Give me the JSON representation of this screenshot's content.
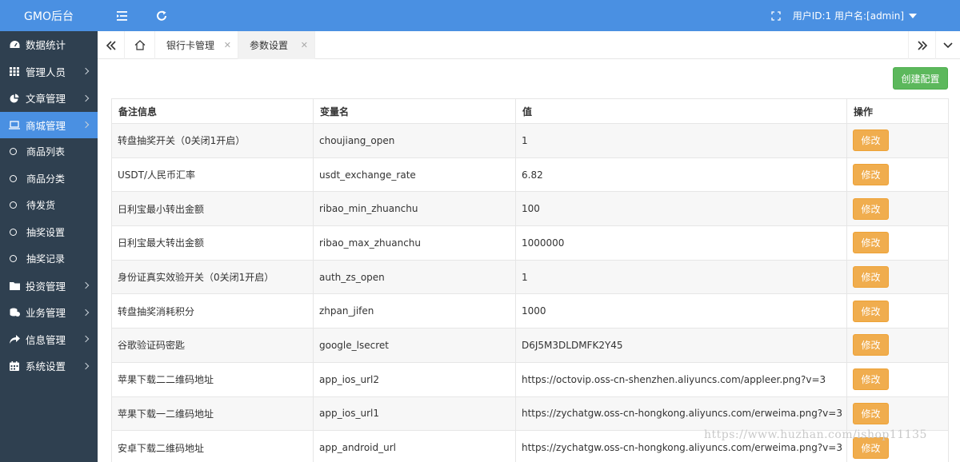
{
  "app": {
    "title": "GMO后台"
  },
  "sidebar": {
    "items": [
      {
        "label": "数据统计",
        "icon": "dashboard-icon",
        "has_arrow": false,
        "active": false
      },
      {
        "label": "管理人员",
        "icon": "grid-icon",
        "has_arrow": true,
        "active": false
      },
      {
        "label": "文章管理",
        "icon": "pie-chart-icon",
        "has_arrow": true,
        "active": false
      },
      {
        "label": "商城管理",
        "icon": "laptop-icon",
        "has_arrow": true,
        "active": true
      },
      {
        "label": "商品列表",
        "sub": true
      },
      {
        "label": "商品分类",
        "sub": true
      },
      {
        "label": "待发货",
        "sub": true
      },
      {
        "label": "抽奖设置",
        "sub": true
      },
      {
        "label": "抽奖记录",
        "sub": true
      },
      {
        "label": "投资管理",
        "icon": "folder-icon",
        "has_arrow": true,
        "active": false
      },
      {
        "label": "业务管理",
        "icon": "coins-icon",
        "has_arrow": true,
        "active": false
      },
      {
        "label": "信息管理",
        "icon": "share-icon",
        "has_arrow": true,
        "active": false
      },
      {
        "label": "系统设置",
        "icon": "calendar-icon",
        "has_arrow": true,
        "active": false
      }
    ]
  },
  "header": {
    "user_label": "用户ID:1 用户名:[admin]"
  },
  "tabs": [
    {
      "label": "银行卡管理",
      "active": false
    },
    {
      "label": "参数设置",
      "active": true
    }
  ],
  "toolbar": {
    "create_label": "创建配置"
  },
  "table": {
    "columns": [
      "备注信息",
      "变量名",
      "值",
      "操作"
    ],
    "edit_label": "修改",
    "rows": [
      {
        "note": "转盘抽奖开关（0关闭1开启）",
        "name": "choujiang_open",
        "value": "1"
      },
      {
        "note": "USDT/人民币汇率",
        "name": "usdt_exchange_rate",
        "value": "6.82"
      },
      {
        "note": "日利宝最小转出金额",
        "name": "ribao_min_zhuanchu",
        "value": "100"
      },
      {
        "note": "日利宝最大转出金额",
        "name": "ribao_max_zhuanchu",
        "value": "1000000"
      },
      {
        "note": "身份证真实效验开关（0关闭1开启）",
        "name": "auth_zs_open",
        "value": "1"
      },
      {
        "note": "转盘抽奖消耗积分",
        "name": "zhpan_jifen",
        "value": "1000"
      },
      {
        "note": "谷歌验证码密匙",
        "name": "google_lsecret",
        "value": "D6J5M3DLDMFK2Y45"
      },
      {
        "note": "苹果下载二二维码地址",
        "name": "app_ios_url2",
        "value": "https://octovip.oss-cn-shenzhen.aliyuncs.com/appleer.png?v=3"
      },
      {
        "note": "苹果下载一二维码地址",
        "name": "app_ios_url1",
        "value": "https://zychatgw.oss-cn-hongkong.aliyuncs.com/erweima.png?v=3"
      },
      {
        "note": "安卓下载二维码地址",
        "name": "app_android_url",
        "value": "https://zychatgw.oss-cn-hongkong.aliyuncs.com/erweima.png?v=3"
      }
    ]
  },
  "watermark": "https://www.huzhan.com/ishop11135",
  "colors": {
    "sidebar_bg": "#2f4050",
    "accent": "#4a90e2",
    "create_btn": "#5cb85c",
    "edit_btn": "#f0ad4e"
  }
}
